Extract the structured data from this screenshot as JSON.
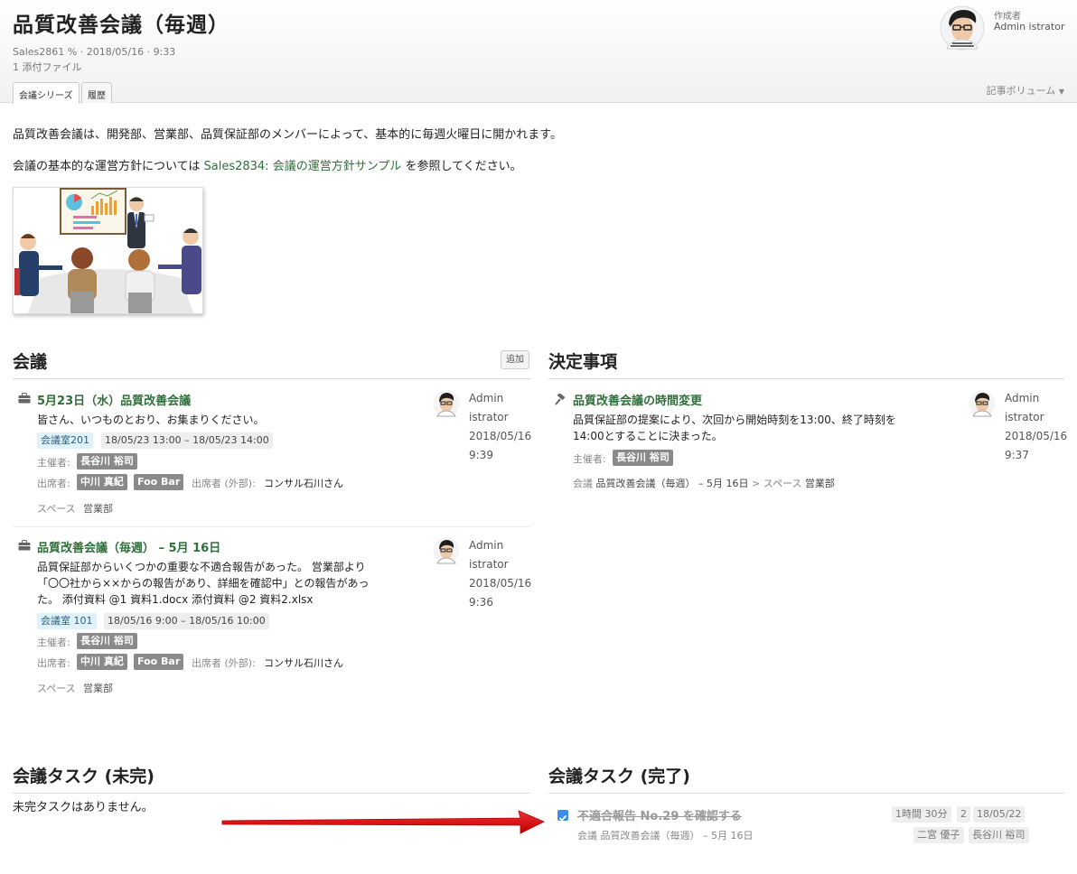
{
  "page": {
    "title": "品質改善会議（毎週）",
    "meta_line": "Sales2861 % · 2018/05/16 · 9:33",
    "attachments": "1 添付ファイル",
    "author_label": "作成者",
    "author_name": "Admin istrator",
    "tabs": [
      "会議シリーズ",
      "履歴"
    ],
    "volume_label": "記事ボリューム"
  },
  "body": {
    "para1": "品質改善会議は、開発部、営業部、品質保証部のメンバーによって、基本的に毎週火曜日に開かれます。",
    "para2_prefix": "会議の基本的な運営方針については",
    "para2_link": "Sales2834: 会議の運営方針サンプル",
    "para2_suffix": "を参照してください。"
  },
  "meetings": {
    "heading": "会議",
    "add_label": "追加",
    "items": [
      {
        "title": "5月23日（水）品質改善会議",
        "text": "皆さん、いつものとおり、お集まりください。",
        "room": "会議室201",
        "time": "18/05/23 13:00 – 18/05/23 14:00",
        "host_label": "主催者:",
        "host": "長谷川 裕司",
        "attendee_label": "出席者:",
        "attendees": [
          "中川 真紀",
          "Foo Bar"
        ],
        "external_label": "出席者 (外部):",
        "external": "コンサル石川さん",
        "space_label": "スペース",
        "space": "営業部",
        "author_line1": "Admin",
        "author_line2": "istrator",
        "date": "2018/05/16",
        "time_posted": "9:39"
      },
      {
        "title": "品質改善会議（毎週） – 5月 16日",
        "text_line1": "品質保証部からいくつかの重要な不適合報告があった。 営業部より",
        "text_line2": "「〇〇社から××からの報告があり、詳細を確認中」との報告があっ",
        "text_line3": "た。 添付資料 @1 資料1.docx 添付資料 @2 資料2.xlsx",
        "room": "会議室 101",
        "time": "18/05/16 9:00 – 18/05/16 10:00",
        "host_label": "主催者:",
        "host": "長谷川 裕司",
        "attendee_label": "出席者:",
        "attendees": [
          "中川 真紀",
          "Foo Bar"
        ],
        "external_label": "出席者 (外部):",
        "external": "コンサル石川さん",
        "space_label": "スペース",
        "space": "営業部",
        "author_line1": "Admin",
        "author_line2": "istrator",
        "date": "2018/05/16",
        "time_posted": "9:36"
      }
    ]
  },
  "decisions": {
    "heading": "決定事項",
    "items": [
      {
        "title": "品質改善会議の時間変更",
        "text_line1": "品質保証部の提案により、次回から開始時刻を13:00、終了時刻を",
        "text_line2": "14:00とすることに決まった。",
        "host_label": "主催者:",
        "host": "長谷川 裕司",
        "path_prefix": "会議",
        "path_meeting": "品質改善会議（毎週） – 5月 16日",
        "path_sep": ">",
        "path_space_label": "スペース",
        "path_space": "営業部",
        "author_line1": "Admin",
        "author_line2": "istrator",
        "date": "2018/05/16",
        "time_posted": "9:37"
      }
    ]
  },
  "tasks_open": {
    "heading": "会議タスク (未完)",
    "empty": "未完タスクはありません。"
  },
  "tasks_done": {
    "heading": "会議タスク (完了)",
    "items": [
      {
        "title": "不適合報告 No.29 を確認する",
        "checked": true,
        "path_prefix": "会議",
        "path_meeting": "品質改善会議（毎週） – 5月 16日",
        "duration": "1時間 30分",
        "count": "2",
        "date": "18/05/22",
        "assignees": [
          "二宮 優子",
          "長谷川 裕司"
        ]
      }
    ]
  },
  "colors": {
    "link": "#2f6f3a",
    "arrow": "#e01010",
    "checkbox": "#3b8ee8"
  }
}
